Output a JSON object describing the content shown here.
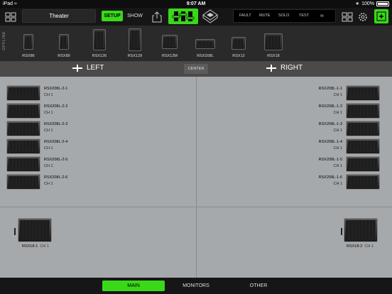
{
  "status_bar": {
    "device": "iPad",
    "time": "9:07 AM",
    "battery": "100%"
  },
  "toolbar": {
    "venue_name": "Theater",
    "setup_label": "SETUP",
    "show_label": "SHOW",
    "status_labels": [
      "FAULT",
      "MUTE",
      "SOLO",
      "TEST"
    ],
    "accent_color": "#39d91a"
  },
  "palette": {
    "offline_label": "OFFLINE",
    "items": [
      "RSX86",
      "RSX89",
      "RSX126",
      "RSX129",
      "RSX12M",
      "RSX208L",
      "RSX12",
      "RSX18"
    ]
  },
  "sides": {
    "left": "LEFT",
    "center": "CENTER",
    "right": "RIGHT"
  },
  "left_speakers": [
    {
      "name": "RSX208L-2-1",
      "ch": "CH 1"
    },
    {
      "name": "RSX208L-2-2",
      "ch": "CH 1"
    },
    {
      "name": "RSX208L-2-3",
      "ch": "CH 1"
    },
    {
      "name": "RSX208L-2-4",
      "ch": "CH 1"
    },
    {
      "name": "RSX208L-2-5",
      "ch": "CH 1"
    },
    {
      "name": "RSX208L-2-6",
      "ch": "CH 1"
    }
  ],
  "right_speakers": [
    {
      "name": "RSX208L-1-1",
      "ch": "CH 1"
    },
    {
      "name": "RSX208L-1-2",
      "ch": "CH 1"
    },
    {
      "name": "RSX208L-1-3",
      "ch": "CH 1"
    },
    {
      "name": "RSX208L-1-4",
      "ch": "CH 1"
    },
    {
      "name": "RSX208L-1-5",
      "ch": "CH 1"
    },
    {
      "name": "RSX208L-1-6",
      "ch": "CH 1"
    }
  ],
  "subs": {
    "left": {
      "name": "RSX18-1",
      "ch": "CH 1"
    },
    "right": {
      "name": "RSX18-2",
      "ch": "CH 1"
    }
  },
  "bottom_tabs": [
    "MAIN",
    "MONITORS",
    "OTHER"
  ],
  "active_tab": "MAIN"
}
